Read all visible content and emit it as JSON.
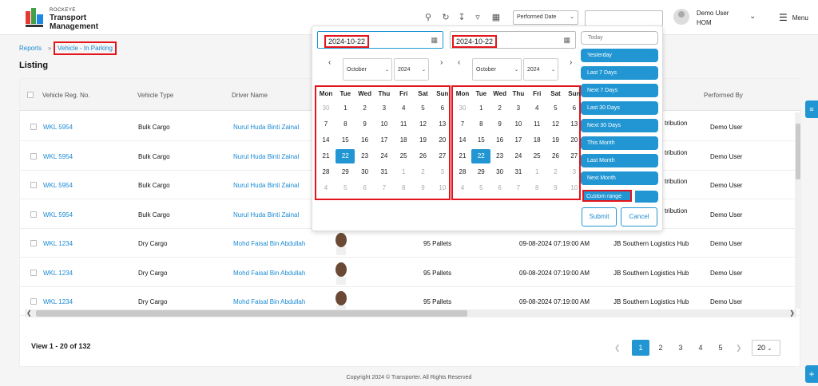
{
  "brand": {
    "sub": "ROCKEYE",
    "title_line1": "Transport",
    "title_line2": "Management"
  },
  "header": {
    "performed_select": "Performed Date",
    "user_name": "Demo User",
    "user_org": "HOM",
    "menu_label": "Menu"
  },
  "breadcrumb": {
    "reports": "Reports",
    "current": "Vehicle - In Parking"
  },
  "page": {
    "title": "Listing"
  },
  "table": {
    "columns": [
      "Vehicle Reg. No.",
      "Vehicle Type",
      "Driver Name",
      "Performed By"
    ],
    "rows": [
      {
        "reg": "WKL 5954",
        "type": "Bulk Cargo",
        "driver": "Nurul Huda Binti Zainal",
        "load": "",
        "time": "",
        "hub": "tribution",
        "performed_by": "Demo User"
      },
      {
        "reg": "WKL 5954",
        "type": "Bulk Cargo",
        "driver": "Nurul Huda Binti Zainal",
        "load": "",
        "time": "",
        "hub": "tribution",
        "performed_by": "Demo User"
      },
      {
        "reg": "WKL 5954",
        "type": "Bulk Cargo",
        "driver": "Nurul Huda Binti Zainal",
        "load": "",
        "time": "",
        "hub": "tribution",
        "performed_by": "Demo User"
      },
      {
        "reg": "WKL 5954",
        "type": "Bulk Cargo",
        "driver": "Nurul Huda Binti Zainal",
        "load": "",
        "time": "",
        "hub": "tribution",
        "performed_by": "Demo User"
      },
      {
        "reg": "WKL 1234",
        "type": "Dry Cargo",
        "driver": "Mohd Faisal Bin Abdullah",
        "load": "95 Pallets",
        "time": "09-08-2024 07:19:00 AM",
        "hub": "JB Southern Logistics Hub",
        "performed_by": "Demo User"
      },
      {
        "reg": "WKL 1234",
        "type": "Dry Cargo",
        "driver": "Mohd Faisal Bin Abdullah",
        "load": "95 Pallets",
        "time": "09-08-2024 07:19:00 AM",
        "hub": "JB Southern Logistics Hub",
        "performed_by": "Demo User"
      },
      {
        "reg": "WKL 1234",
        "type": "Dry Cargo",
        "driver": "Mohd Faisal Bin Abdullah",
        "load": "95 Pallets",
        "time": "09-08-2024 07:19:00 AM",
        "hub": "JB Southern Logistics Hub",
        "performed_by": "Demo User"
      }
    ]
  },
  "pagination": {
    "summary": "View 1 - 20 of 132",
    "pages": [
      "1",
      "2",
      "3",
      "4",
      "5"
    ],
    "page_size": "20"
  },
  "footer": {
    "copyright": "Copyright 2024 © Transporter. All Rights Reserved"
  },
  "datepicker": {
    "start_value": "2024-10-22",
    "end_value": "2024-10-22",
    "left_month": "October",
    "left_year": "2024",
    "right_month": "October",
    "right_year": "2024",
    "weekdays": [
      "Mon",
      "Tue",
      "Wed",
      "Thu",
      "Fri",
      "Sat",
      "Sun"
    ],
    "days": [
      "30",
      "1",
      "2",
      "3",
      "4",
      "5",
      "6",
      "7",
      "8",
      "9",
      "10",
      "11",
      "12",
      "13",
      "14",
      "15",
      "16",
      "17",
      "18",
      "19",
      "20",
      "21",
      "22",
      "23",
      "24",
      "25",
      "26",
      "27",
      "28",
      "29",
      "30",
      "31",
      "1",
      "2",
      "3",
      "4",
      "5",
      "6",
      "7",
      "8",
      "9",
      "10"
    ],
    "ranges": [
      "Today",
      "Yesterday",
      "Last 7 Days",
      "Next 7 Days",
      "Last 30 Days",
      "Next 30 Days",
      "This Month",
      "Last Month",
      "Next Month",
      "Custom range"
    ],
    "submit": "Submit",
    "cancel": "Cancel"
  },
  "colors": {
    "accent": "#2196d3",
    "highlight": "#e3151b"
  }
}
